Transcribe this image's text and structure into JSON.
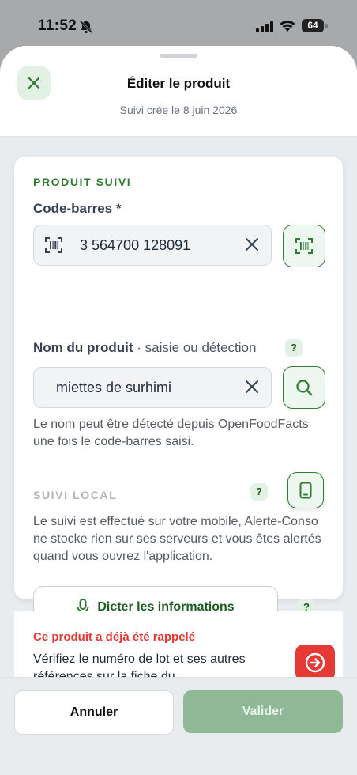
{
  "status_bar": {
    "time": "11:52",
    "battery": "64"
  },
  "header": {
    "title": "Éditer le produit",
    "subtitle": "Suivi crée le 8 juin 2026"
  },
  "product_section": {
    "title": "PRODUIT SUIVI",
    "barcode_label": "Code-barres *",
    "barcode_value": "3 564700 128091",
    "name_label": "Nom du produit",
    "name_label_suffix": " · saisie ou détection",
    "name_value": "miettes de surhimi",
    "name_hint": "Le nom peut être détecté depuis OpenFoodFacts une fois le code-barres saisi.",
    "help": "?"
  },
  "local_section": {
    "title": "SUIVI LOCAL",
    "text": "Le suivi est effectué sur votre mobile, Alerte-Conso ne stocke rien sur ses serveurs et vous êtes alertés quand vous ouvrez l'application.",
    "dictate_label": "Dicter les informations"
  },
  "alert": {
    "title": "Ce produit a déjà été rappelé",
    "text": "Vérifiez le numéro de lot et ses autres références sur la fiche du"
  },
  "footer": {
    "cancel_label": "Annuler",
    "validate_label": "Valider"
  },
  "colors": {
    "accent": "#2e7d32",
    "danger": "#e53935",
    "validate_disabled": "#8fb897"
  },
  "icons": [
    "close-icon",
    "barcode-icon",
    "scan-icon",
    "search-icon",
    "clear-icon",
    "phone-icon",
    "microphone-icon",
    "arrow-circle-icon"
  ]
}
